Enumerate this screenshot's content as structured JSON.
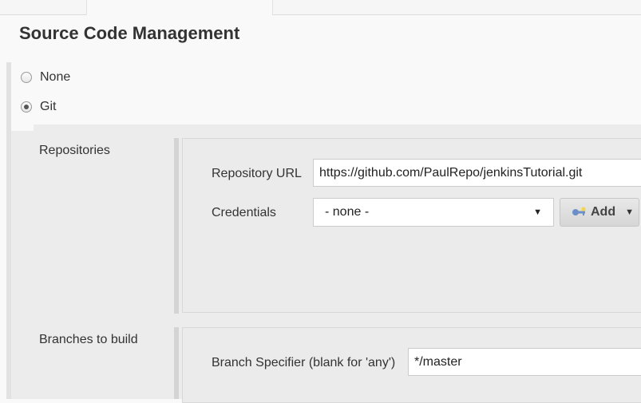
{
  "section": {
    "title": "Source Code Management",
    "options": [
      {
        "label": "None",
        "checked": false
      },
      {
        "label": "Git",
        "checked": true
      }
    ]
  },
  "git": {
    "repositories_label": "Repositories",
    "repository_url_label": "Repository URL",
    "repository_url_value": "https://github.com/PaulRepo/jenkinsTutorial.git",
    "credentials_label": "Credentials",
    "credentials_selected": "- none -",
    "add_button_label": "Add",
    "branches_label": "Branches to build",
    "branch_specifier_label": "Branch Specifier (blank for 'any')",
    "branch_specifier_value": "*/master"
  },
  "colors": {
    "page_bg": "#f9f9f9",
    "panel_bg": "#ececec",
    "text": "#333333",
    "key_icon_blue": "#6b8fc6",
    "key_icon_yellow": "#f2d54b"
  }
}
